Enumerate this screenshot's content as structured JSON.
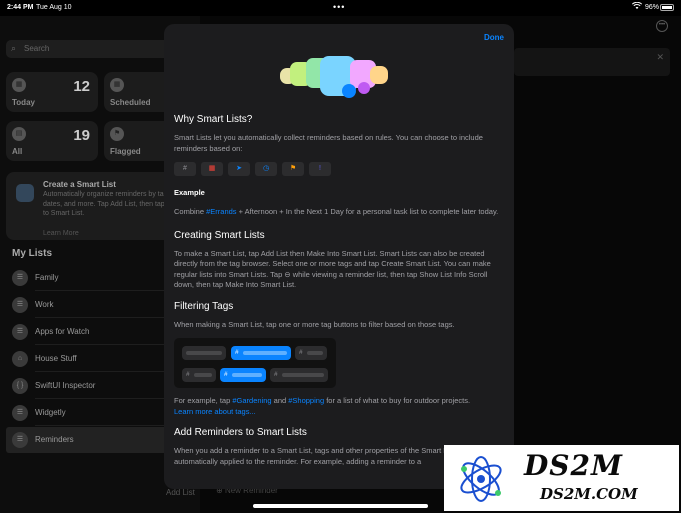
{
  "status_bar": {
    "time": "2:44 PM",
    "date": "Tue Aug 10",
    "battery": "96%"
  },
  "sidebar": {
    "search_placeholder": "Search",
    "tiles": [
      {
        "label": "Today",
        "count": "12"
      },
      {
        "label": "Scheduled",
        "count": ""
      },
      {
        "label": "All",
        "count": "19"
      },
      {
        "label": "Flagged",
        "count": ""
      }
    ],
    "promo": {
      "title": "Create a Smart List",
      "body": "Automatically organize reminders by tags, due dates, and more. Tap Add List, then tap Convert to Smart List.",
      "link": "Learn More"
    },
    "my_lists_title": "My Lists",
    "lists": [
      "Family",
      "Work",
      "Apps for Watch",
      "House Stuff",
      "SwiftUI Inspector",
      "Widgetly",
      "Reminders"
    ],
    "add_list": "Add List"
  },
  "main": {
    "new_reminder": "New Reminder"
  },
  "sheet": {
    "done_label": "Done",
    "why_title": "Why Smart Lists?",
    "why_body": "Smart Lists let you automatically collect reminders based on rules. You can choose to include reminders based on:",
    "criteria_icons": [
      {
        "name": "tag-icon",
        "glyph": "#",
        "color": "#8e8e93"
      },
      {
        "name": "calendar-icon",
        "glyph": "▦",
        "color": "#ff453a"
      },
      {
        "name": "location-icon",
        "glyph": "➤",
        "color": "#0a84ff"
      },
      {
        "name": "clock-icon",
        "glyph": "◷",
        "color": "#0a84ff"
      },
      {
        "name": "flag-icon",
        "glyph": "⚑",
        "color": "#ff9f0a"
      },
      {
        "name": "priority-icon",
        "glyph": "!",
        "color": "#5e5ce6"
      }
    ],
    "example_title": "Example",
    "example_prefix": "Combine ",
    "example_tag": "#Errands",
    "example_suffix": " + Afternoon + In the Next 1 Day for a personal task list to complete later today.",
    "creating_title": "Creating Smart Lists",
    "creating_body": "To make a Smart List, tap Add List then Make Into Smart List. Smart Lists can also be created directly from the tag browser. Select one or more tags and tap Create Smart List. You can make regular lists into Smart Lists. Tap ⊖ while viewing a reminder list, then tap Show List Info Scroll down, then tap Make Into Smart List.",
    "filtering_title": "Filtering Tags",
    "filtering_body": "When making a Smart List, tap one or more tag buttons to filter based on those tags.",
    "filter_prefix": "For example, tap ",
    "filter_tag1": "#Gardening",
    "filter_mid": " and ",
    "filter_tag2": "#Shopping",
    "filter_suffix": " for a list of what to buy for outdoor projects.",
    "learn_more": "Learn more about tags...",
    "add_title": "Add Reminders to Smart Lists",
    "add_body": "When you add a reminder to a Smart List, tags and other properties of the Smart List are automatically applied to the reminder. For example, adding a reminder to a"
  },
  "watermark": {
    "name": "DS2M",
    "url": "DS2M.COM"
  }
}
